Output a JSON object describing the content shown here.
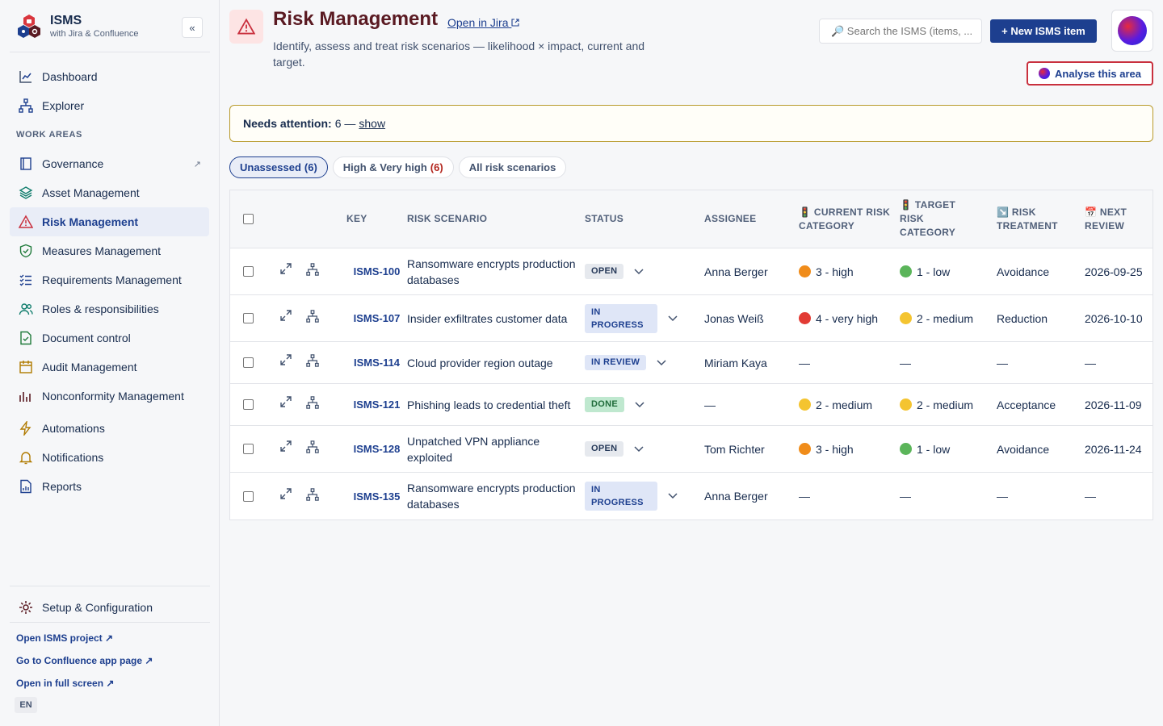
{
  "brand": {
    "title": "ISMS",
    "subtitle": "with Jira & Confluence",
    "collapse_label": "«"
  },
  "sidebar": {
    "items": [
      {
        "label": "Dashboard"
      },
      {
        "label": "Explorer"
      }
    ],
    "section_label": "WORK AREAS",
    "work_areas": [
      {
        "label": "Governance",
        "ext": "↗"
      },
      {
        "label": "Asset Management"
      },
      {
        "label": "Risk Management"
      },
      {
        "label": "Measures Management"
      },
      {
        "label": "Requirements Management"
      },
      {
        "label": "Roles & responsibilities"
      },
      {
        "label": "Document control"
      },
      {
        "label": "Audit Management"
      },
      {
        "label": "Nonconformity Management"
      }
    ],
    "tools": [
      {
        "label": "Automations"
      },
      {
        "label": "Notifications"
      },
      {
        "label": "Reports"
      }
    ],
    "setup_label": "Setup & Configuration",
    "footer_links": [
      "Open ISMS project ↗",
      "Go to Confluence app page ↗",
      "Open in full screen ↗"
    ],
    "language": "EN"
  },
  "header": {
    "title": "Risk Management",
    "open_jira": "Open in Jira",
    "description": "Identify, assess and treat risk scenarios — likelihood × impact, current and target.",
    "search_placeholder": "🔎 Search the ISMS (items, ...",
    "new_button": "+ New ISMS item",
    "analyse_button": "Analyse this area"
  },
  "attention": {
    "label": "Needs attention:",
    "value": "6 —",
    "link": "show"
  },
  "filters": [
    {
      "label": "Unassessed",
      "count": "(6)"
    },
    {
      "label": "High & Very high",
      "count": "(6)"
    },
    {
      "label": "All risk scenarios",
      "count": ""
    }
  ],
  "table": {
    "columns": {
      "key": "KEY",
      "scenario": "RISK SCENARIO",
      "status": "STATUS",
      "assignee": "ASSIGNEE",
      "current": "🚦 CURRENT RISK CATEGORY",
      "target": "🚦 TARGET RISK CATEGORY",
      "treatment": "↘️ RISK TREATMENT",
      "review": "📅 NEXT REVIEW"
    },
    "rows": [
      {
        "key": "ISMS-100",
        "scenario": "Ransomware encrypts production databases",
        "status": "OPEN",
        "assignee": "Anna Berger",
        "current": "3 - high",
        "target": "1 - low",
        "treatment": "Avoidance",
        "review": "2026-09-25"
      },
      {
        "key": "ISMS-107",
        "scenario": "Insider exfiltrates customer data",
        "status": "IN PROGRESS",
        "assignee": "Jonas Weiß",
        "current": "4 - very high",
        "target": "2 - medium",
        "treatment": "Reduction",
        "review": "2026-10-10"
      },
      {
        "key": "ISMS-114",
        "scenario": "Cloud provider region outage",
        "status": "IN REVIEW",
        "assignee": "Miriam Kaya",
        "current": "—",
        "target": "—",
        "treatment": "—",
        "review": "—"
      },
      {
        "key": "ISMS-121",
        "scenario": "Phishing leads to credential theft",
        "status": "DONE",
        "assignee": "—",
        "current": "2 - medium",
        "target": "2 - medium",
        "treatment": "Acceptance",
        "review": "2026-11-09"
      },
      {
        "key": "ISMS-128",
        "scenario": "Unpatched VPN appliance exploited",
        "status": "OPEN",
        "assignee": "Tom Richter",
        "current": "3 - high",
        "target": "1 - low",
        "treatment": "Avoidance",
        "review": "2026-11-24"
      },
      {
        "key": "ISMS-135",
        "scenario": "Ransomware encrypts production databases",
        "status": "IN PROGRESS",
        "assignee": "Anna Berger",
        "current": "—",
        "target": "—",
        "treatment": "—",
        "review": "—"
      }
    ]
  },
  "colors": {
    "primary": "#1d3f8f",
    "title": "#5a1a22",
    "high": "#f08c1a",
    "very_high": "#e23b34",
    "medium": "#f4c430",
    "low": "#5bb55a"
  }
}
